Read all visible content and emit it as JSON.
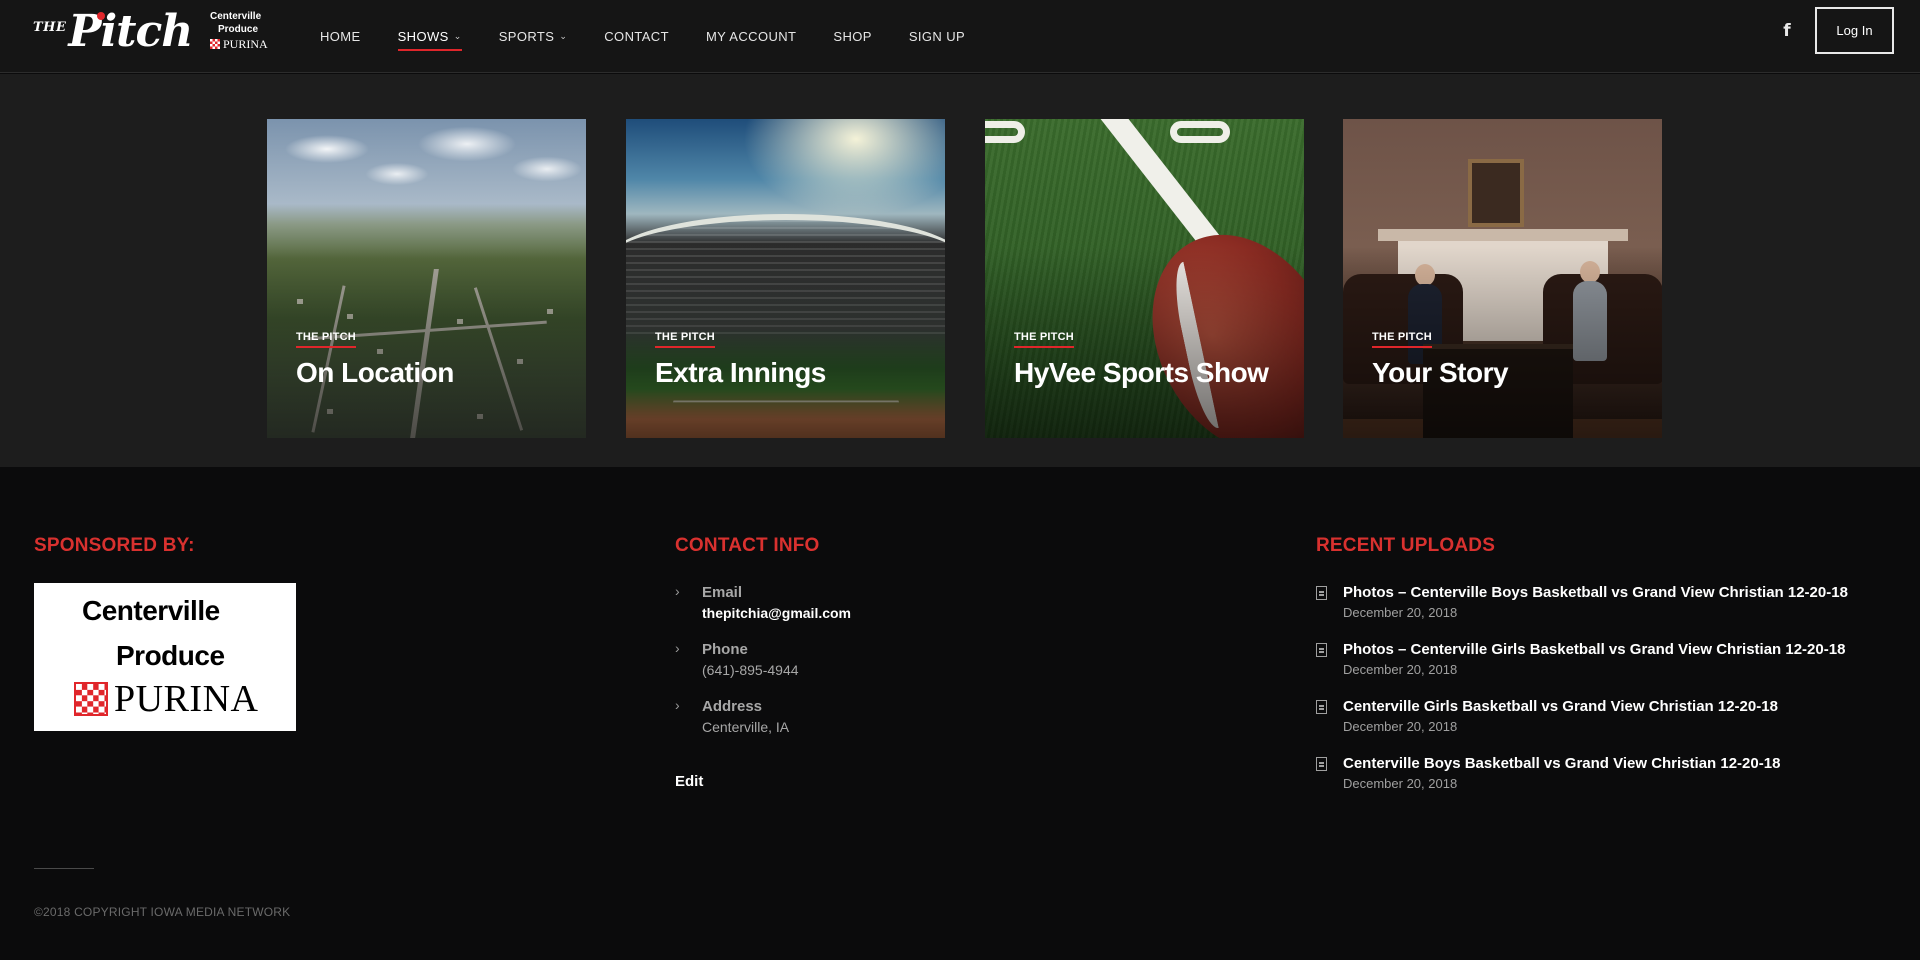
{
  "header": {
    "logo": {
      "the": "THE",
      "pitch": "Pitch"
    },
    "sponsor_mini": {
      "line1": "Centerville",
      "line2": "Produce",
      "line3": "PURINA"
    },
    "nav": [
      {
        "label": "HOME"
      },
      {
        "label": "SHOWS",
        "dropdown": true,
        "active": true
      },
      {
        "label": "SPORTS",
        "dropdown": true
      },
      {
        "label": "CONTACT"
      },
      {
        "label": "MY ACCOUNT"
      },
      {
        "label": "SHOP"
      },
      {
        "label": "SIGN UP"
      }
    ],
    "caret": "⌄",
    "social_icon": "f",
    "login_label": "Log In"
  },
  "shows": [
    {
      "kicker": "THE PITCH",
      "title": "On Location"
    },
    {
      "kicker": "THE PITCH",
      "title": "Extra Innings"
    },
    {
      "kicker": "THE PITCH",
      "title": "HyVee Sports Show"
    },
    {
      "kicker": "THE PITCH",
      "title": "Your Story"
    }
  ],
  "footer": {
    "sponsored": {
      "title": "SPONSORED BY:",
      "logo_line1": "Centerville",
      "logo_line2": "Produce",
      "logo_line3": "PURINA"
    },
    "contact": {
      "title": "CONTACT INFO",
      "chevron": "›",
      "items": [
        {
          "label": "Email",
          "value": "thepitchia@gmail.com"
        },
        {
          "label": "Phone",
          "value": "(641)-895-4944"
        },
        {
          "label": "Address",
          "value": "Centerville, IA"
        }
      ],
      "edit_label": "Edit"
    },
    "uploads": {
      "title": "RECENT UPLOADS",
      "items": [
        {
          "title": "Photos – Centerville Boys Basketball vs Grand View Christian 12-20-18",
          "date": "December 20, 2018"
        },
        {
          "title": "Photos – Centerville Girls Basketball vs Grand View Christian 12-20-18",
          "date": "December 20, 2018"
        },
        {
          "title": "Centerville Girls Basketball vs Grand View Christian 12-20-18",
          "date": "December 20, 2018"
        },
        {
          "title": "Centerville Boys Basketball vs Grand View Christian 12-20-18",
          "date": "December 20, 2018"
        }
      ]
    },
    "copyright": "©2018 COPYRIGHT IOWA MEDIA NETWORK"
  },
  "colors": {
    "accent": "#e0262b",
    "header_bg": "#151515",
    "band_bg": "#1d1d1d",
    "footer_bg": "#0b0b0c"
  }
}
